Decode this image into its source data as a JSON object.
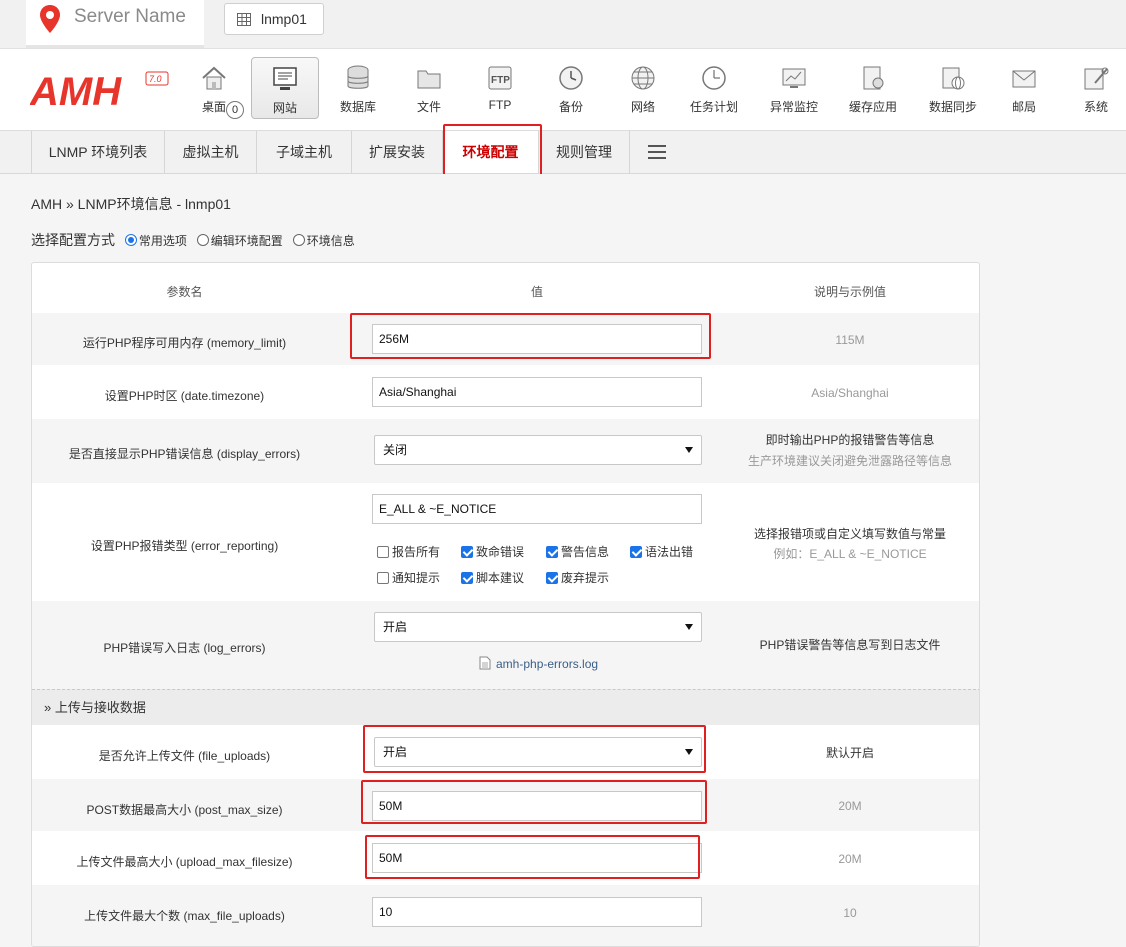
{
  "topbar": {
    "server_name": "Server Name",
    "instance_tab": "lnmp01"
  },
  "nav": {
    "badge_count": "0",
    "items": [
      {
        "label": "桌面",
        "icon": "home-icon"
      },
      {
        "label": "网站",
        "icon": "monitor-icon"
      },
      {
        "label": "数据库",
        "icon": "database-icon"
      },
      {
        "label": "文件",
        "icon": "folder-icon"
      },
      {
        "label": "FTP",
        "icon": "ftp-icon"
      },
      {
        "label": "备份",
        "icon": "backup-clock-icon"
      },
      {
        "label": "网络",
        "icon": "globe-icon"
      },
      {
        "label": "任务计划",
        "icon": "clock-icon"
      },
      {
        "label": "异常监控",
        "icon": "monitor-chart-icon"
      },
      {
        "label": "缓存应用",
        "icon": "cache-icon"
      },
      {
        "label": "数据同步",
        "icon": "sync-icon"
      },
      {
        "label": "邮局",
        "icon": "mail-icon"
      },
      {
        "label": "系统",
        "icon": "settings-icon"
      }
    ]
  },
  "subtabs": [
    "LNMP 环境列表",
    "虚拟主机",
    "子域主机",
    "扩展安装",
    "环境配置",
    "规则管理"
  ],
  "breadcrumb": "AMH » LNMP环境信息 - lnmp01",
  "mode": {
    "label": "选择配置方式",
    "options": [
      "常用选项",
      "编辑环境配置",
      "环境信息"
    ]
  },
  "table": {
    "headers": {
      "name": "参数名",
      "value": "值",
      "desc": "说明与示例值"
    },
    "memory_limit": {
      "name": "运行PHP程序可用内存 (memory_limit)",
      "value": "256M",
      "desc": "115M"
    },
    "timezone": {
      "name": "设置PHP时区 (date.timezone)",
      "value": "Asia/Shanghai",
      "desc": "Asia/Shanghai"
    },
    "display_errors": {
      "name": "是否直接显示PHP错误信息 (display_errors)",
      "value": "关闭",
      "desc1": "即时输出PHP的报错警告等信息",
      "desc2": "生产环境建议关闭避免泄露路径等信息"
    },
    "error_reporting": {
      "name": "设置PHP报错类型 (error_reporting)",
      "value": "E_ALL & ~E_NOTICE",
      "desc1": "选择报错项或自定义填写数值与常量",
      "desc2": "例如：E_ALL & ~E_NOTICE",
      "checks": [
        {
          "label": "报告所有",
          "checked": false
        },
        {
          "label": "致命错误",
          "checked": true
        },
        {
          "label": "警告信息",
          "checked": true
        },
        {
          "label": "语法出错",
          "checked": true
        },
        {
          "label": "通知提示",
          "checked": false
        },
        {
          "label": "脚本建议",
          "checked": true
        },
        {
          "label": "废弃提示",
          "checked": true
        }
      ]
    },
    "log_errors": {
      "name": "PHP错误写入日志 (log_errors)",
      "value": "开启",
      "log_file": "amh-php-errors.log",
      "desc": "PHP错误警告等信息写到日志文件"
    },
    "section_upload": "» 上传与接收数据",
    "file_uploads": {
      "name": "是否允许上传文件 (file_uploads)",
      "value": "开启",
      "desc": "默认开启"
    },
    "post_max_size": {
      "name": "POST数据最高大小 (post_max_size)",
      "value": "50M",
      "desc": "20M"
    },
    "upload_max_filesize": {
      "name": "上传文件最高大小 (upload_max_filesize)",
      "value": "50M",
      "desc": "20M"
    },
    "max_file_uploads": {
      "name": "上传文件最大个数 (max_file_uploads)",
      "value": "10",
      "desc": "10"
    }
  },
  "colors": {
    "accent_red": "#e02020",
    "logo_red": "#e8352b",
    "checkbox_blue": "#1a73e8"
  }
}
